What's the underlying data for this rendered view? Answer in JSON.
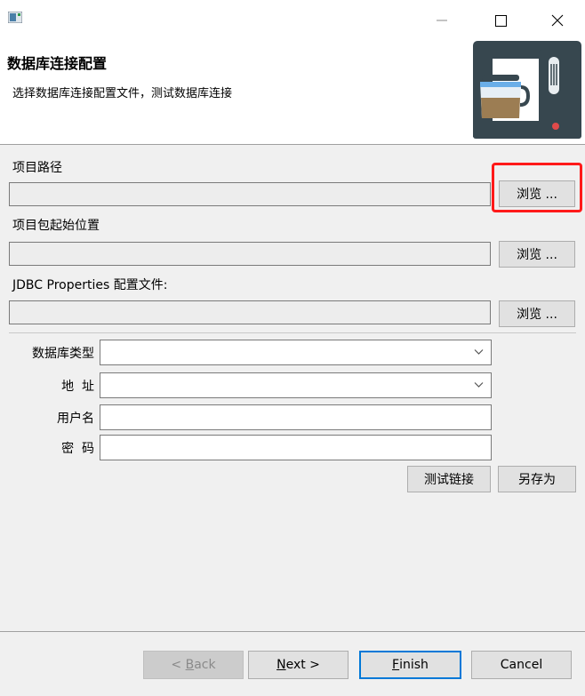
{
  "project_path": {
    "label": "项目路径",
    "value": "",
    "browse_label": "浏览 ..."
  },
  "package_start": {
    "label": "项目包起始位置",
    "value": "",
    "browse_label": "浏览 ..."
  },
  "jdbc_properties": {
    "label": "JDBC Properties 配置文件:",
    "value": "",
    "browse_label": "浏览 ..."
  },
  "header": {
    "title": "数据库连接配置",
    "description": "选择数据库连接配置文件，测试数据库连接"
  },
  "db_form": {
    "db_type_label": "数据库类型",
    "db_type_value": "",
    "address_label": "地  址",
    "address_value": "",
    "username_label": "用户名",
    "username_value": "",
    "password_label": "密  码",
    "password_value": "",
    "test_connection_label": "测试链接",
    "save_as_label": "另存为"
  },
  "wizard_nav": {
    "back_prefix": "< ",
    "back_mnemonic": "B",
    "back_rest": "ack",
    "next_mnemonic": "N",
    "next_rest": "ext >",
    "finish_mnemonic": "F",
    "finish_rest": "inish",
    "cancel_label": "Cancel"
  },
  "icons": {
    "app": "app-window-icon",
    "minimize": "minimize-icon",
    "maximize": "maximize-icon",
    "close": "close-icon",
    "header_image": "coffee-machine-icon"
  },
  "colors": {
    "highlight": "#ff1a1a",
    "focus": "#0078d7",
    "machine": "#37474f",
    "coffee": "#9c7d53",
    "glass": "#6aaee8"
  }
}
